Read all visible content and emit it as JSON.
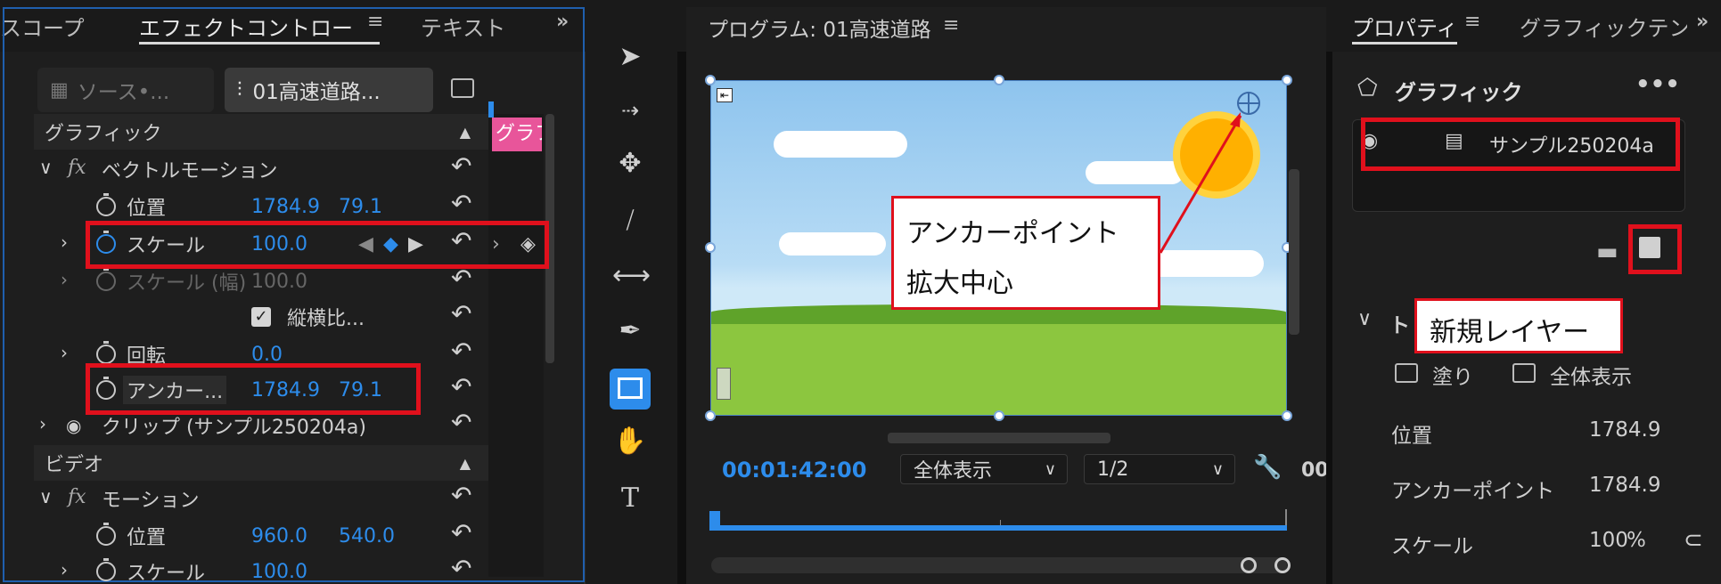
{
  "effect_panel": {
    "tabs": [
      "スコープ",
      "エフェクトコントロー",
      "テキスト"
    ],
    "source_tab": "ソース•...",
    "sequence_tab": "01高速道路...",
    "sequence_tab_overlay": "グラフ",
    "section_graphic": "グラフィック",
    "vector_motion": "ベクトルモーション",
    "position": {
      "label": "位置",
      "x": "1784.9",
      "y": "79.1"
    },
    "scale": {
      "label": "スケール",
      "value": "100.0"
    },
    "scale_width": {
      "label": "スケール (幅)",
      "value": "100.0"
    },
    "uniform_scale": "縦横比...",
    "rotation": {
      "label": "回転",
      "value": "0.0"
    },
    "anchor": {
      "label": "アンカー...",
      "x": "1784.9",
      "y": "79.1"
    },
    "clip": "クリップ (サンプル250204a)",
    "section_video": "ビデオ",
    "motion": "モーション",
    "motion_position": {
      "label": "位置",
      "x": "960.0",
      "y": "540.0"
    },
    "motion_scale": {
      "label": "スケール",
      "value": "100.0"
    }
  },
  "program": {
    "title": "プログラム: 01高速道路",
    "timecode": "00:01:42:00",
    "zoom": "全体表示",
    "resolution": "1/2",
    "extra": "00"
  },
  "callouts": {
    "anchor_line1": "アンカーポイント",
    "anchor_line2": "拡大中心",
    "new_layer": "新規レイヤー"
  },
  "props": {
    "tabs": [
      "プロパティ",
      "グラフィックテン"
    ],
    "graphic": "グラフィック",
    "layer_name": "サンプル250204a",
    "section_initial": "ト",
    "fill": "塗り",
    "fit": "全体表示",
    "position": {
      "label": "位置",
      "value": "1784.9"
    },
    "anchor": {
      "label": "アンカーポイント",
      "value": "1784.9"
    },
    "scale": {
      "label": "スケール",
      "value": "100",
      "unit": "%"
    }
  },
  "colors": {
    "accent": "#2d8ceb",
    "highlight": "#e0101c"
  }
}
